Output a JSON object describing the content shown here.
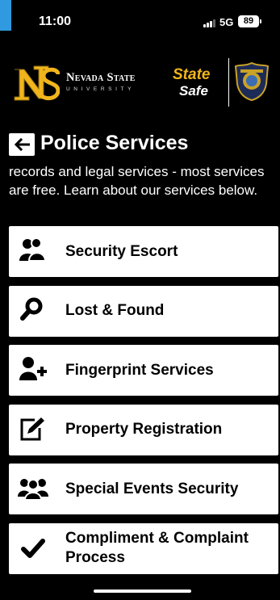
{
  "status_bar": {
    "time": "11:00",
    "network": "5G",
    "battery": "89"
  },
  "brand": {
    "university_name": "Nevada State",
    "university_sub": "UNIVERSITY",
    "state_safe_line1": "State",
    "state_safe_line2": "Safe",
    "gold_color": "#f1b51c"
  },
  "header": {
    "back_icon": "arrow-left-icon",
    "title": "Police Services"
  },
  "intro_text": "records and legal services - most services are free. Learn about our services below.",
  "services": [
    {
      "label": "Security Escort",
      "icon": "users-icon"
    },
    {
      "label": "Lost & Found",
      "icon": "magnifier-icon"
    },
    {
      "label": "Fingerprint Services",
      "icon": "user-plus-icon"
    },
    {
      "label": "Property Registration",
      "icon": "edit-icon"
    },
    {
      "label": "Special Events Security",
      "icon": "group-icon"
    },
    {
      "label": "Compliment & Complaint Process",
      "icon": "checkmark-icon"
    }
  ]
}
